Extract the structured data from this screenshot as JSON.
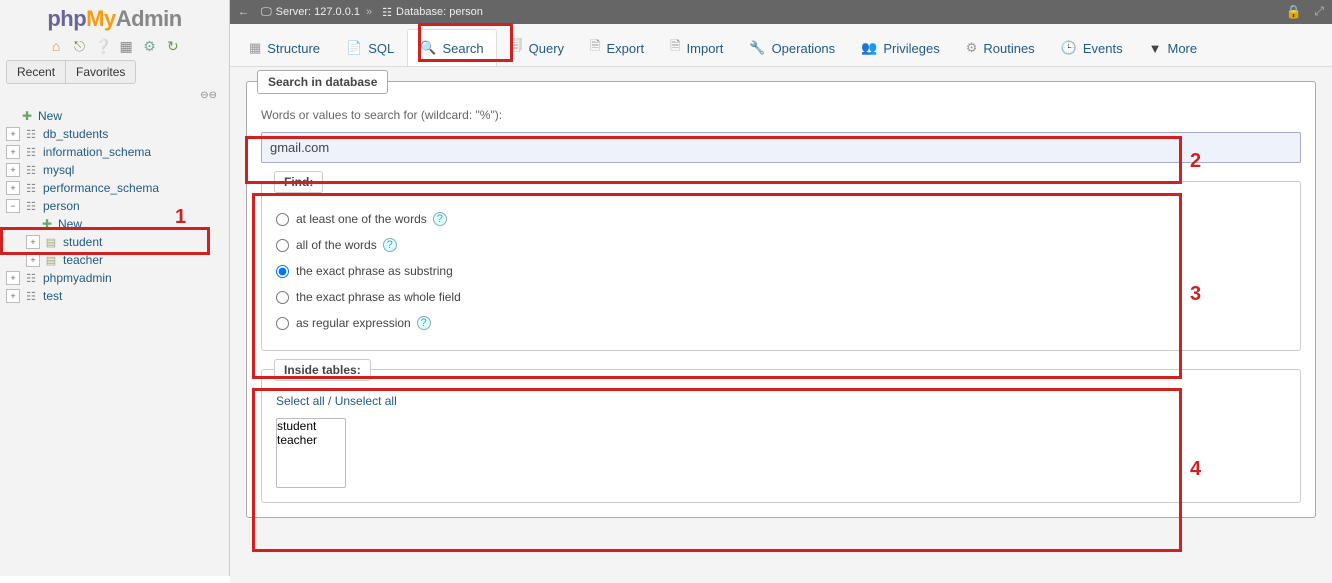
{
  "logo": {
    "php": "php",
    "my": "My",
    "admin": "Admin"
  },
  "sidebar_tabs": {
    "recent": "Recent",
    "favorites": "Favorites"
  },
  "tree": {
    "new": "New",
    "items": [
      {
        "label": "db_students"
      },
      {
        "label": "information_schema"
      },
      {
        "label": "mysql"
      },
      {
        "label": "performance_schema"
      },
      {
        "label": "person"
      },
      {
        "label": "phpmyadmin"
      },
      {
        "label": "test"
      }
    ],
    "person_children": {
      "new": "New",
      "tables": [
        "student",
        "teacher"
      ]
    }
  },
  "serverbar": {
    "server_label": "Server:",
    "server_value": "127.0.0.1",
    "db_label": "Database:",
    "db_value": "person"
  },
  "tabs": [
    {
      "label": "Structure"
    },
    {
      "label": "SQL"
    },
    {
      "label": "Search"
    },
    {
      "label": "Query"
    },
    {
      "label": "Export"
    },
    {
      "label": "Import"
    },
    {
      "label": "Operations"
    },
    {
      "label": "Privileges"
    },
    {
      "label": "Routines"
    },
    {
      "label": "Events"
    },
    {
      "label": "More"
    }
  ],
  "search": {
    "panel_title": "Search in database",
    "hint": "Words or values to search for (wildcard: \"%\"):",
    "value": "gmail.com",
    "find_legend": "Find:",
    "options": [
      "at least one of the words",
      "all of the words",
      "the exact phrase as substring",
      "the exact phrase as whole field",
      "as regular expression"
    ],
    "inside_legend": "Inside tables:",
    "select_all": "Select all",
    "unselect_all": "Unselect all",
    "tables": [
      "student",
      "teacher"
    ]
  },
  "annotations": {
    "n1": "1",
    "n2": "2",
    "n3": "3",
    "n4": "4"
  }
}
